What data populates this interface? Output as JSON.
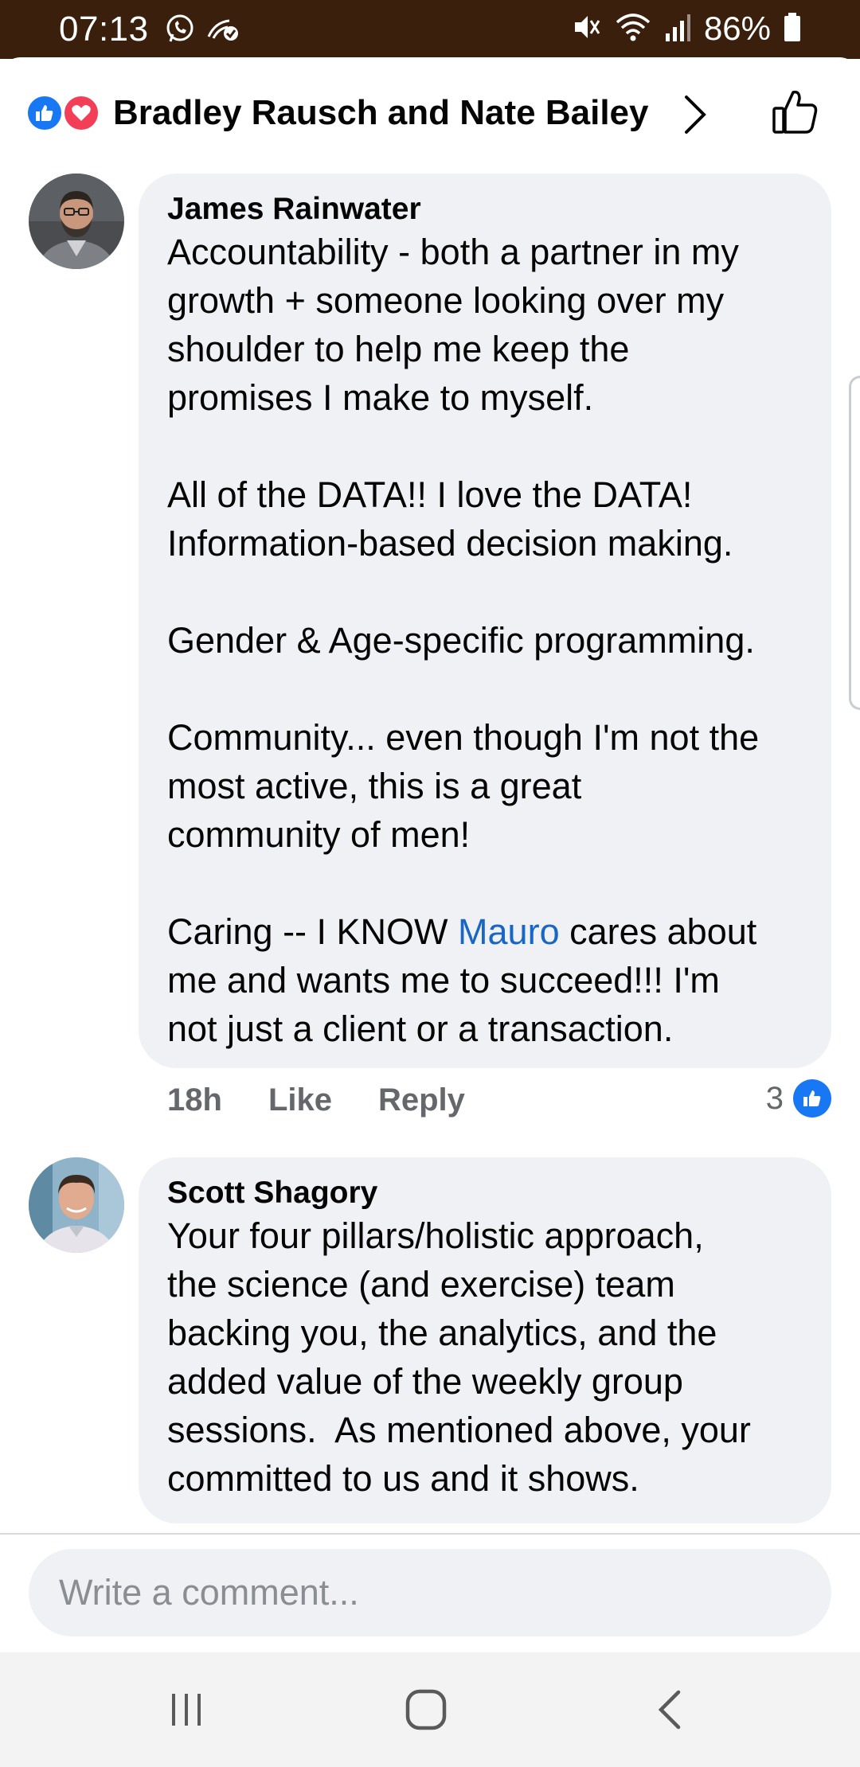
{
  "status_bar": {
    "time": "07:13",
    "battery": "86%",
    "icons": [
      "whatsapp-icon",
      "wifi-calling-icon",
      "mute-icon",
      "wifi-icon",
      "signal-icon",
      "battery-icon"
    ]
  },
  "header": {
    "reactions": [
      "like",
      "love"
    ],
    "reactors_label": "Bradley Rausch and Nate Bailey",
    "like_icon": "thumbs-up-outline-icon"
  },
  "comments": [
    {
      "author": "James Rainwater",
      "paragraphs": [
        [
          "Accountability - both a partner in my",
          "growth + someone looking over my",
          "shoulder to help me keep the",
          "promises I make to myself."
        ],
        [
          "All of the DATA!! I love the DATA!",
          "Information-based decision making."
        ],
        [
          "Gender & Age-specific programming."
        ],
        [
          "Community... even though I'm not the",
          "most active, this is a great",
          "community of men!"
        ]
      ],
      "last_paragraph": {
        "line1_before": "Caring -- I KNOW ",
        "mention": "Mauro",
        "line1_after": " cares about",
        "rest": [
          "me and wants me to succeed!!! I'm",
          "not just a client or a transaction."
        ]
      },
      "time": "18h",
      "like_label": "Like",
      "reply_label": "Reply",
      "like_count": "3"
    },
    {
      "author": "Scott Shagory",
      "lines": [
        "Your four pillars/holistic approach,",
        "the science (and exercise) team",
        "backing you, the analytics, and the",
        "added value of the weekly group",
        "sessions.  As mentioned above, your",
        "committed to us and it shows."
      ]
    }
  ],
  "composer": {
    "placeholder": "Write a comment..."
  },
  "colors": {
    "status_bar_bg": "#3a1f0c",
    "bubble_bg": "#eff1f4",
    "link_blue": "#1a66c5",
    "facebook_blue": "#1877f2",
    "love_red": "#f33e58"
  }
}
